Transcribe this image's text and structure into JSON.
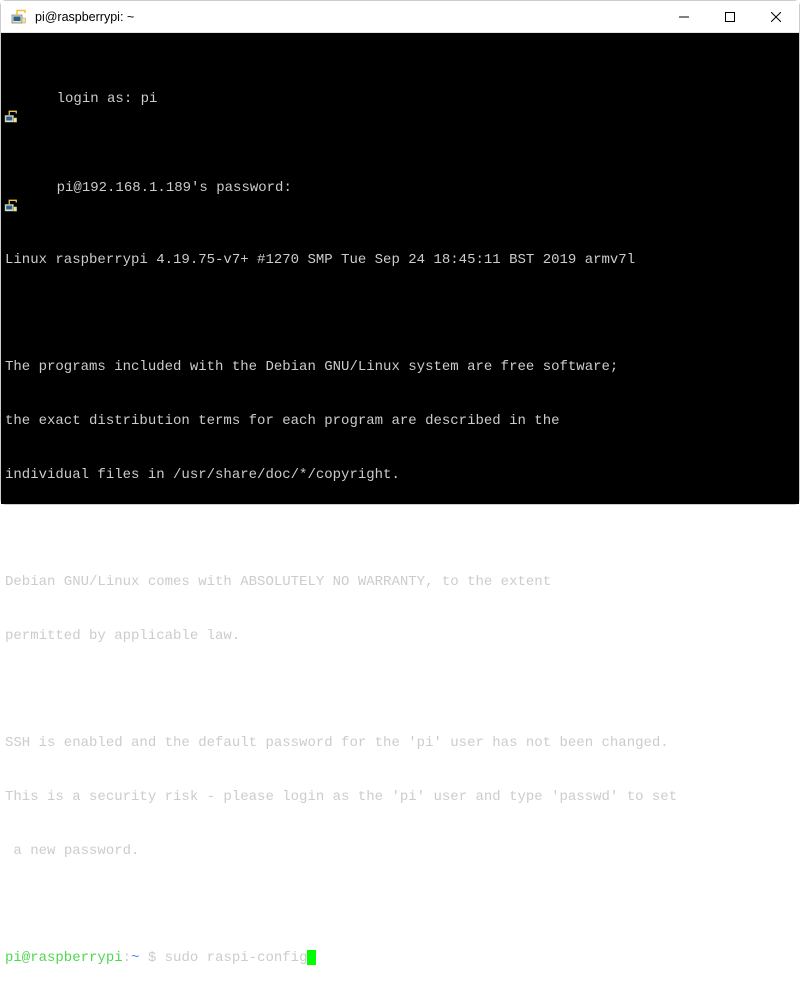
{
  "window": {
    "title": "pi@raspberrypi: ~"
  },
  "terminal": {
    "login_prompt": "login as: pi",
    "password_prompt": "pi@192.168.1.189's password:",
    "linux_line": "Linux raspberrypi 4.19.75-v7+ #1270 SMP Tue Sep 24 18:45:11 BST 2019 armv7l",
    "motd1": "The programs included with the Debian GNU/Linux system are free software;",
    "motd2": "the exact distribution terms for each program are described in the",
    "motd3": "individual files in /usr/share/doc/*/copyright.",
    "motd4": "Debian GNU/Linux comes with ABSOLUTELY NO WARRANTY, to the extent",
    "motd5": "permitted by applicable law.",
    "ssh1": "SSH is enabled and the default password for the 'pi' user has not been changed.",
    "ssh2": "This is a security risk - please login as the 'pi' user and type 'passwd' to set",
    "ssh3": " a new password.",
    "prompt_userhost": "pi@raspberrypi",
    "prompt_colon": ":",
    "prompt_path": "~",
    "prompt_dollar": " $ ",
    "prompt_command": "sudo raspi-config"
  }
}
